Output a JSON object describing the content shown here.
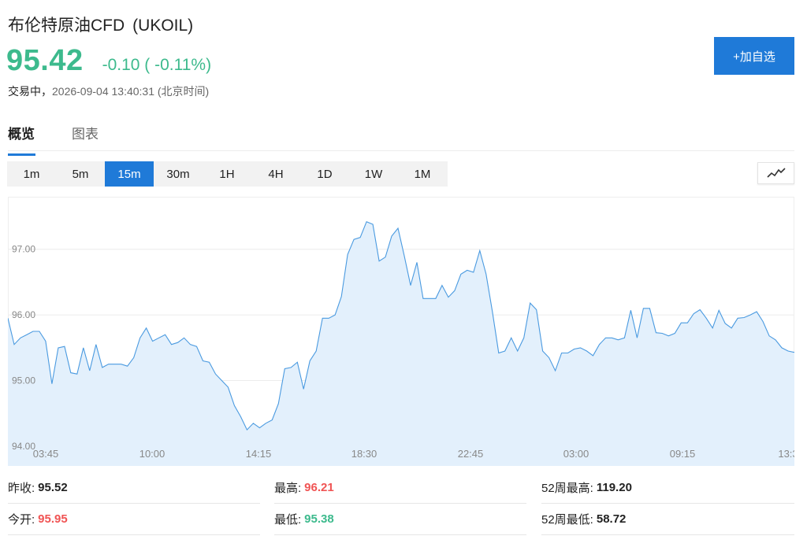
{
  "header": {
    "name": "布伦特原油CFD",
    "code": "(UKOIL)",
    "price": "95.42",
    "change": "-0.10 ( -0.11%)",
    "status_label": "交易中，",
    "timestamp": "2026-09-04 13:40:31",
    "timezone": "(北京时间)",
    "watch_button": "+加自选"
  },
  "tabs": [
    {
      "label": "概览",
      "active": true
    },
    {
      "label": "图表",
      "active": false
    }
  ],
  "ranges": [
    {
      "label": "1m",
      "active": false
    },
    {
      "label": "5m",
      "active": false
    },
    {
      "label": "15m",
      "active": true
    },
    {
      "label": "30m",
      "active": false
    },
    {
      "label": "1H",
      "active": false
    },
    {
      "label": "4H",
      "active": false
    },
    {
      "label": "1D",
      "active": false
    },
    {
      "label": "1W",
      "active": false
    },
    {
      "label": "1M",
      "active": false
    }
  ],
  "chart_type_icon": "line-chart-icon",
  "colors": {
    "down": "#3dba8d",
    "up": "#f05454",
    "accent": "#1f7ad8",
    "line": "#4a9ae0",
    "fill": "#e3f0fc"
  },
  "chart_data": {
    "type": "area",
    "x_tick_labels": [
      "03:45",
      "10:00",
      "14:15",
      "18:30",
      "22:45",
      "03:00",
      "09:15",
      "13:3"
    ],
    "y_tick_labels": [
      "97.00",
      "96.00",
      "95.00",
      "94.00"
    ],
    "ylim": [
      93.7,
      97.8
    ],
    "grid": true,
    "values": [
      95.95,
      95.55,
      95.65,
      95.7,
      95.75,
      95.75,
      95.6,
      94.95,
      95.5,
      95.52,
      95.12,
      95.1,
      95.5,
      95.15,
      95.55,
      95.2,
      95.25,
      95.25,
      95.25,
      95.22,
      95.35,
      95.65,
      95.8,
      95.6,
      95.65,
      95.7,
      95.55,
      95.58,
      95.65,
      95.55,
      95.52,
      95.3,
      95.28,
      95.1,
      95.0,
      94.9,
      94.62,
      94.45,
      94.25,
      94.35,
      94.28,
      94.35,
      94.4,
      94.65,
      95.18,
      95.2,
      95.28,
      94.87,
      95.3,
      95.45,
      95.95,
      95.95,
      96.0,
      96.28,
      96.92,
      97.15,
      97.18,
      97.42,
      97.38,
      96.82,
      96.88,
      97.2,
      97.32,
      96.9,
      96.45,
      96.8,
      96.25,
      96.25,
      96.25,
      96.45,
      96.27,
      96.37,
      96.62,
      96.68,
      96.65,
      96.98,
      96.62,
      96.05,
      95.42,
      95.45,
      95.65,
      95.45,
      95.65,
      96.18,
      96.08,
      95.45,
      95.35,
      95.15,
      95.42,
      95.42,
      95.48,
      95.5,
      95.45,
      95.38,
      95.55,
      95.65,
      95.65,
      95.62,
      95.65,
      96.07,
      95.65,
      96.1,
      96.1,
      95.73,
      95.72,
      95.68,
      95.72,
      95.88,
      95.88,
      96.02,
      96.08,
      95.95,
      95.8,
      96.07,
      95.87,
      95.8,
      95.95,
      95.96,
      96.0,
      96.05,
      95.9,
      95.68,
      95.62,
      95.5,
      95.45,
      95.43
    ]
  },
  "stats": {
    "prev_close_label": "昨收:",
    "prev_close": "95.52",
    "high_label": "最高:",
    "high": "96.21",
    "high52_label": "52周最高:",
    "high52": "119.20",
    "open_label": "今开:",
    "open": "95.95",
    "low_label": "最低:",
    "low": "95.38",
    "low52_label": "52周最低:",
    "low52": "58.72"
  }
}
